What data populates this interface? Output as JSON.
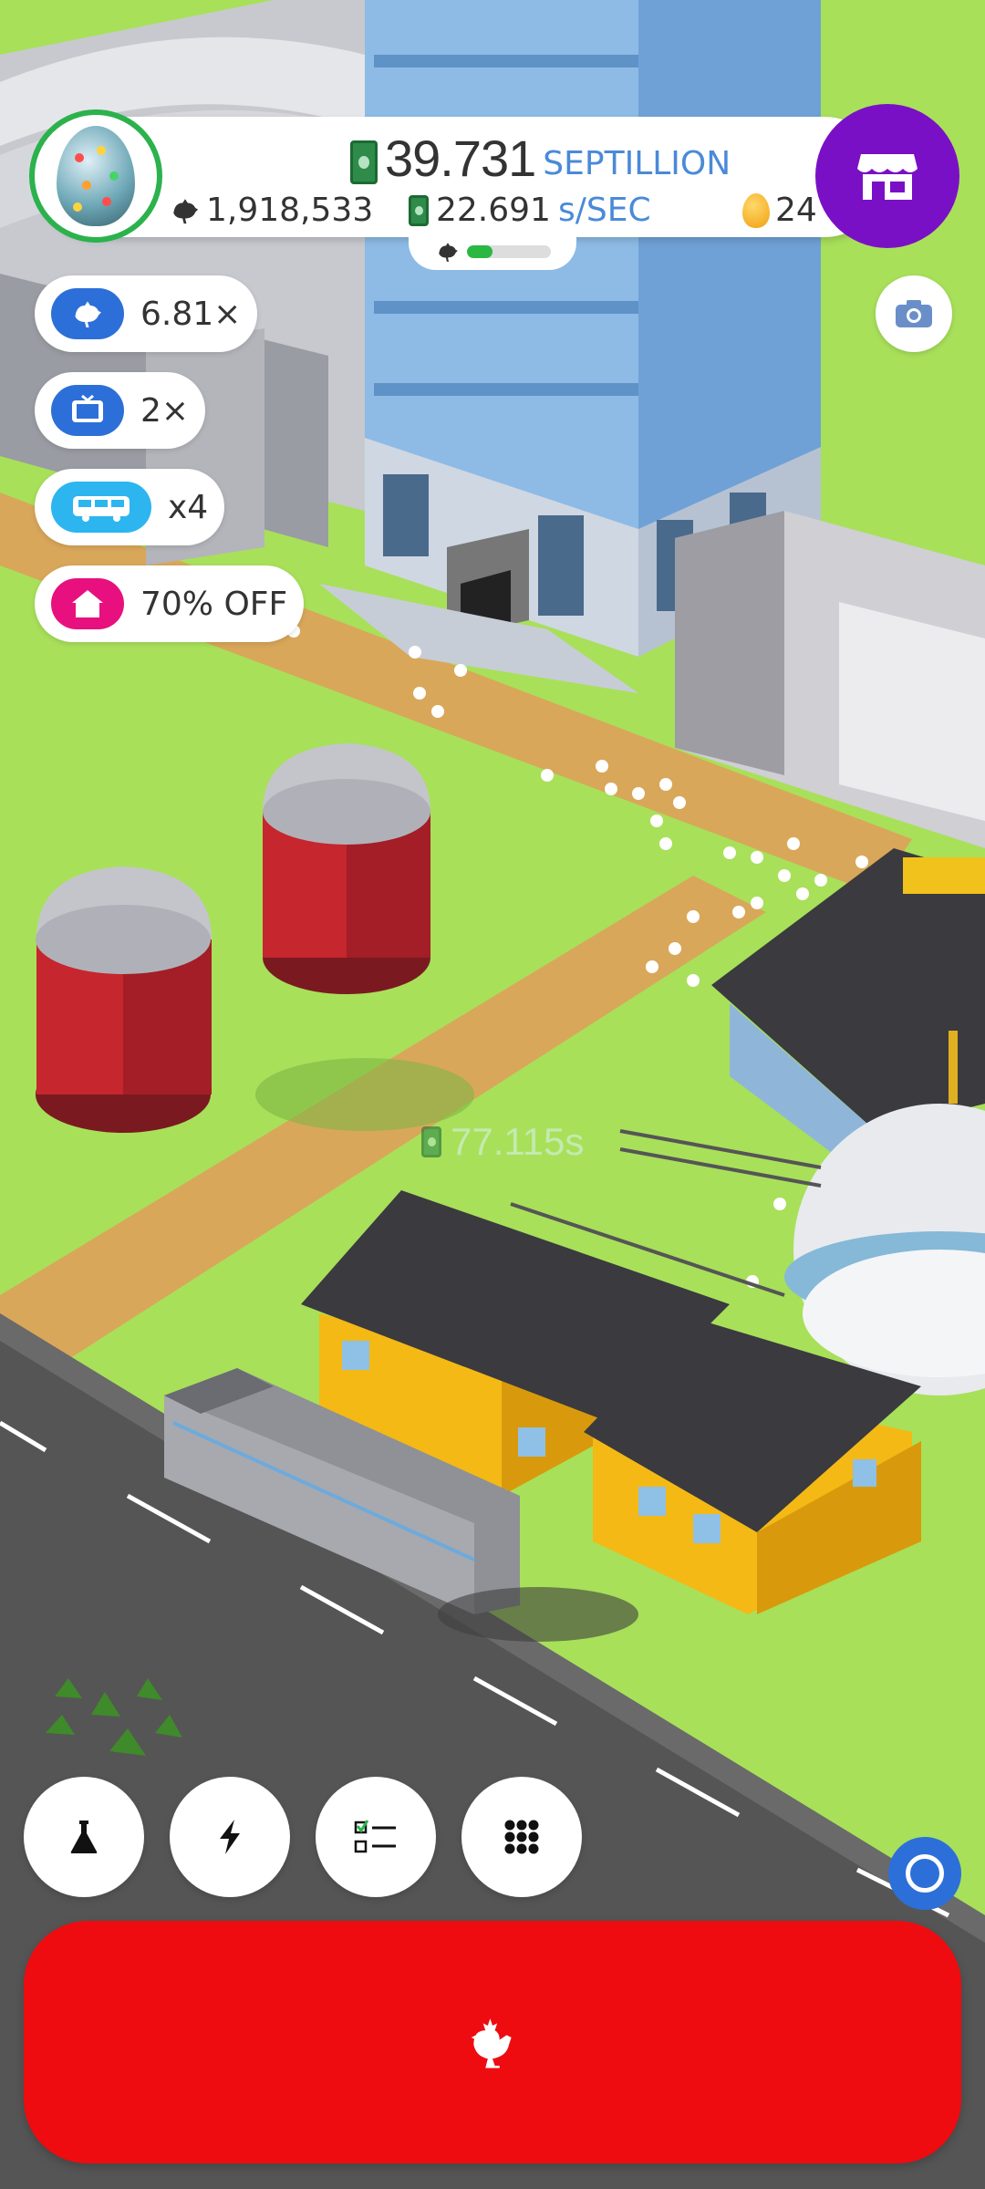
{
  "hud": {
    "money_value": "39.731",
    "money_unit": "SEPTILLION",
    "chicken_count": "1,918,533",
    "earn_rate_value": "22.691",
    "earn_rate_unit": "s/SEC",
    "golden_eggs": "24",
    "habitat_capacity_fraction": 0.3
  },
  "boosts": [
    {
      "label": "6.81×",
      "icon": "chicken-icon",
      "color": "#2d6fd8"
    },
    {
      "label": "2×",
      "icon": "tv-icon",
      "color": "#2d6fd8"
    },
    {
      "label": "x4",
      "icon": "bus-icon",
      "color": "#2db5f0"
    },
    {
      "label": "70% OFF",
      "icon": "house-icon",
      "color": "#e8107e"
    }
  ],
  "floating_earning": "77.115s",
  "bottom_bar": {
    "buttons": [
      "research-flask-icon",
      "boost-lightning-icon",
      "missions-checklist-icon",
      "menu-grid-icon"
    ]
  },
  "colors": {
    "grass": "#a8e05a",
    "road": "#555555",
    "dirt": "#d9a75a",
    "shop_purple": "#7a10c6",
    "hatch_red": "#ee0c10"
  }
}
